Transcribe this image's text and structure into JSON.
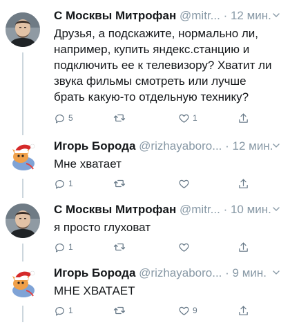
{
  "tweets": [
    {
      "name": "С Москвы Митрофан",
      "handle": "@mitr...",
      "time": "· 12 мин.",
      "text_lines": [
        "Друзья, а подскажите, нормально ли,",
        "например, купить яндекс.станцию и",
        "подключить ее к телевизору? Хватит ли",
        "звука фильмы смотреть или лучше",
        "брать какую-то отдельную технику?"
      ],
      "reply_count": "5",
      "retweet_count": "",
      "like_count": "1"
    },
    {
      "name": "Игорь Борода",
      "handle": "@rizhayaboro...",
      "time": "· 12 мин.",
      "text_lines": [
        "Мне хватает"
      ],
      "reply_count": "1",
      "retweet_count": "",
      "like_count": ""
    },
    {
      "name": "С Москвы Митрофан",
      "handle": "@mitr...",
      "time": "· 10 мин.",
      "text_lines": [
        "я просто глуховат"
      ],
      "reply_count": "1",
      "retweet_count": "",
      "like_count": ""
    },
    {
      "name": "Игорь Борода",
      "handle": "@rizhayaboro...",
      "time": "· 9 мин.",
      "text_lines": [
        "МНЕ ХВАТАЕТ"
      ],
      "reply_count": "1",
      "retweet_count": "",
      "like_count": "9"
    }
  ],
  "colors": {
    "text": "#14171a",
    "secondary": "#8899a6",
    "icon": "#657786",
    "thread_line": "#ccd6dd"
  },
  "icons": {
    "reply": "reply-icon",
    "retweet": "retweet-icon",
    "like": "heart-icon",
    "share": "share-icon",
    "menu": "chevron-down-icon"
  }
}
